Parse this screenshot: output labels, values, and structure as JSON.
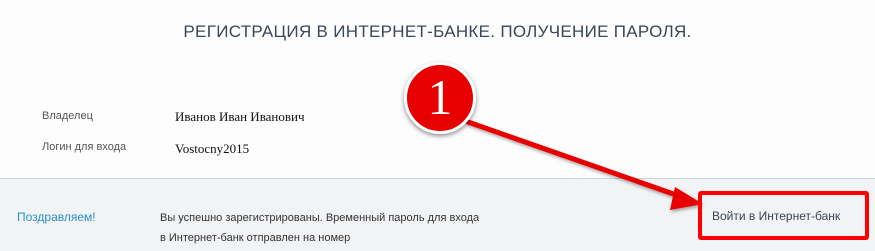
{
  "page": {
    "title": "РЕГИСТРАЦИЯ В ИНТЕРНЕТ-БАНКЕ. ПОЛУЧЕНИЕ ПАРОЛЯ."
  },
  "account": {
    "owner_label": "Владелец",
    "owner_value": "Иванов Иван Иванович",
    "login_label": "Логин для входа",
    "login_value": "Vostocny2015"
  },
  "result": {
    "congrats": "Поздравляем!",
    "message_line1": "Вы успешно зарегистрированы. Временный пароль для входа",
    "message_line2": "в Интернет-банк отправлен на номер",
    "login_link": "Войти в Интернет-банк"
  },
  "annotation": {
    "step_number": "1",
    "color": "#e80000"
  }
}
